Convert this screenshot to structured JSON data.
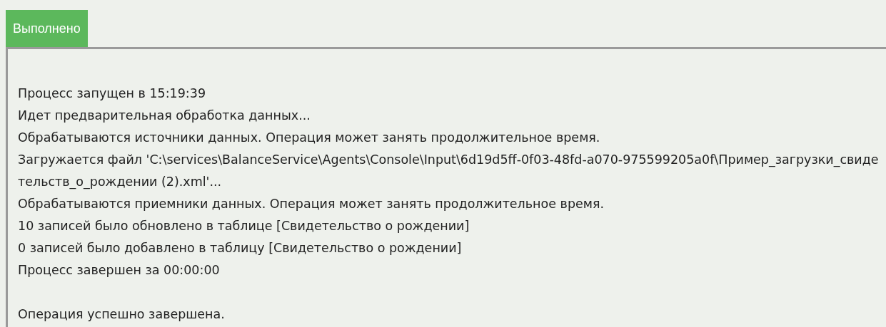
{
  "status_tab": {
    "label": "Выполнено",
    "kind": "success"
  },
  "log_lines": [
    "Процесс запущен в 15:19:39",
    "Идет предварительная обработка данных...",
    "Обрабатываются источники данных. Операция может занять продолжительное время.",
    "Загружается файл 'C:\\services\\BalanceService\\Agents\\Console\\Input\\6d19d5ff-0f03-48fd-a070-975599205a0f\\Пример_загрузки_свидетельств_о_рождении (2).xml'...",
    "Обрабатываются приемники данных. Операция может занять продолжительное время.",
    "10 записей было обновлено в таблице [Свидетельство о рождении]",
    "0 записей было добавлено в таблицу [Свидетельство о рождении]",
    "Процесс завершен за 00:00:00"
  ],
  "result_message": "Операция успешно завершена."
}
